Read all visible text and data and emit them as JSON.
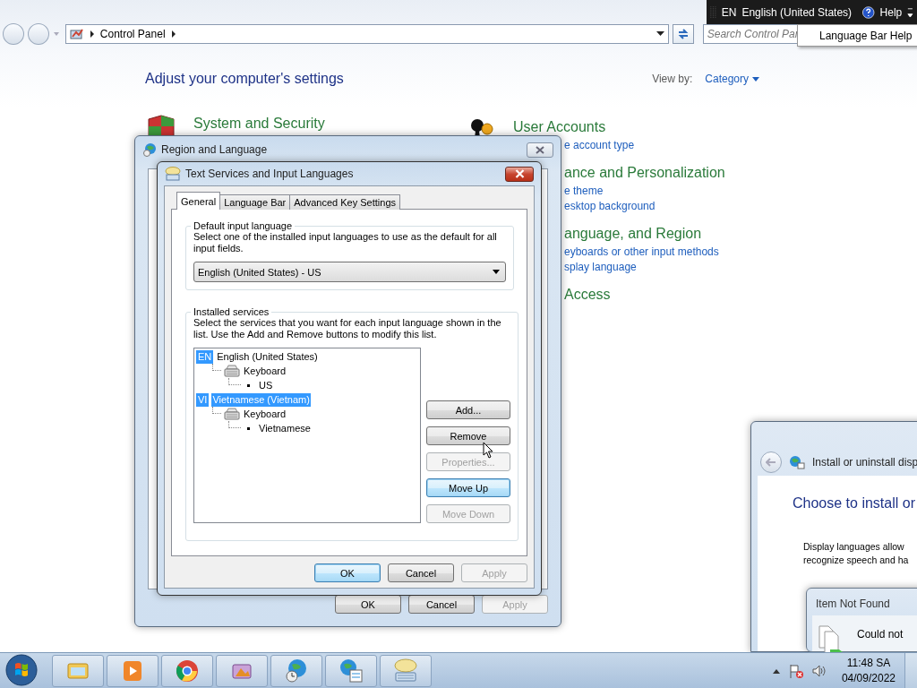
{
  "explorer": {
    "breadcrumb": "Control Panel",
    "search_placeholder": "Search Control Par"
  },
  "language_bar": {
    "code": "EN",
    "language": "English (United States)",
    "help": "Help",
    "menu_item": "Language Bar Help"
  },
  "control_panel": {
    "heading": "Adjust your computer's settings",
    "view_by_label": "View by:",
    "view_by_value": "Category",
    "left_categories": [
      {
        "title": "System and Security"
      }
    ],
    "right_categories": [
      {
        "title": "User Accounts",
        "links": [
          "e account type"
        ]
      },
      {
        "title": "ance and Personalization",
        "links": [
          "e theme",
          "esktop background"
        ]
      },
      {
        "title": "anguage, and Region",
        "links": [
          "eyboards or other input methods",
          "splay language"
        ]
      },
      {
        "title": "Access"
      }
    ]
  },
  "region_dialog": {
    "title": "Region and Language",
    "buttons": [
      {
        "label": "OK",
        "disabled": false,
        "focused": false
      },
      {
        "label": "Cancel",
        "disabled": false,
        "focused": false
      },
      {
        "label": "Apply",
        "disabled": true,
        "focused": false
      }
    ]
  },
  "text_services": {
    "title": "Text Services and Input Languages",
    "tabs": [
      {
        "label": "General",
        "selected": true
      },
      {
        "label": "Language Bar",
        "selected": false
      },
      {
        "label": "Advanced Key Settings",
        "selected": false
      }
    ],
    "default_language": {
      "legend": "Default input language",
      "description": "Select one of the installed input languages to use as the default for all input fields.",
      "value": "English (United States) - US"
    },
    "installed_services": {
      "legend": "Installed services",
      "description": "Select the services that you want for each input language shown in the list. Use the Add and Remove buttons to modify this list.",
      "tree": [
        {
          "kind": "language",
          "badge": "EN",
          "label": "English (United States)",
          "selected": false,
          "children": [
            {
              "kind": "category",
              "label": "Keyboard",
              "children": [
                {
                  "kind": "item",
                  "label": "US"
                }
              ]
            }
          ]
        },
        {
          "kind": "language",
          "badge": "VI",
          "label": "Vietnamese (Vietnam)",
          "selected": true,
          "children": [
            {
              "kind": "category",
              "label": "Keyboard",
              "children": [
                {
                  "kind": "item",
                  "label": "Vietnamese"
                }
              ]
            }
          ]
        }
      ],
      "buttons": [
        {
          "label": "Add...",
          "disabled": false,
          "focused": false
        },
        {
          "label": "Remove",
          "disabled": false,
          "focused": false
        },
        {
          "label": "Properties...",
          "disabled": true,
          "focused": false
        },
        {
          "label": "Move Up",
          "disabled": false,
          "focused": true
        },
        {
          "label": "Move Down",
          "disabled": true,
          "focused": false
        }
      ]
    },
    "buttons": [
      {
        "label": "OK",
        "disabled": false,
        "focused": true
      },
      {
        "label": "Cancel",
        "disabled": false,
        "focused": false
      },
      {
        "label": "Apply",
        "disabled": true,
        "focused": false
      }
    ]
  },
  "install_window": {
    "title": "Install or uninstall disp",
    "heading": "Choose to install or",
    "description_lines": [
      "Display languages allow",
      "recognize speech and ha"
    ]
  },
  "error_dialog": {
    "title": "Item Not Found",
    "message": "Could not"
  },
  "clock": {
    "time": "11:48 SA",
    "date": "04/09/2022"
  }
}
